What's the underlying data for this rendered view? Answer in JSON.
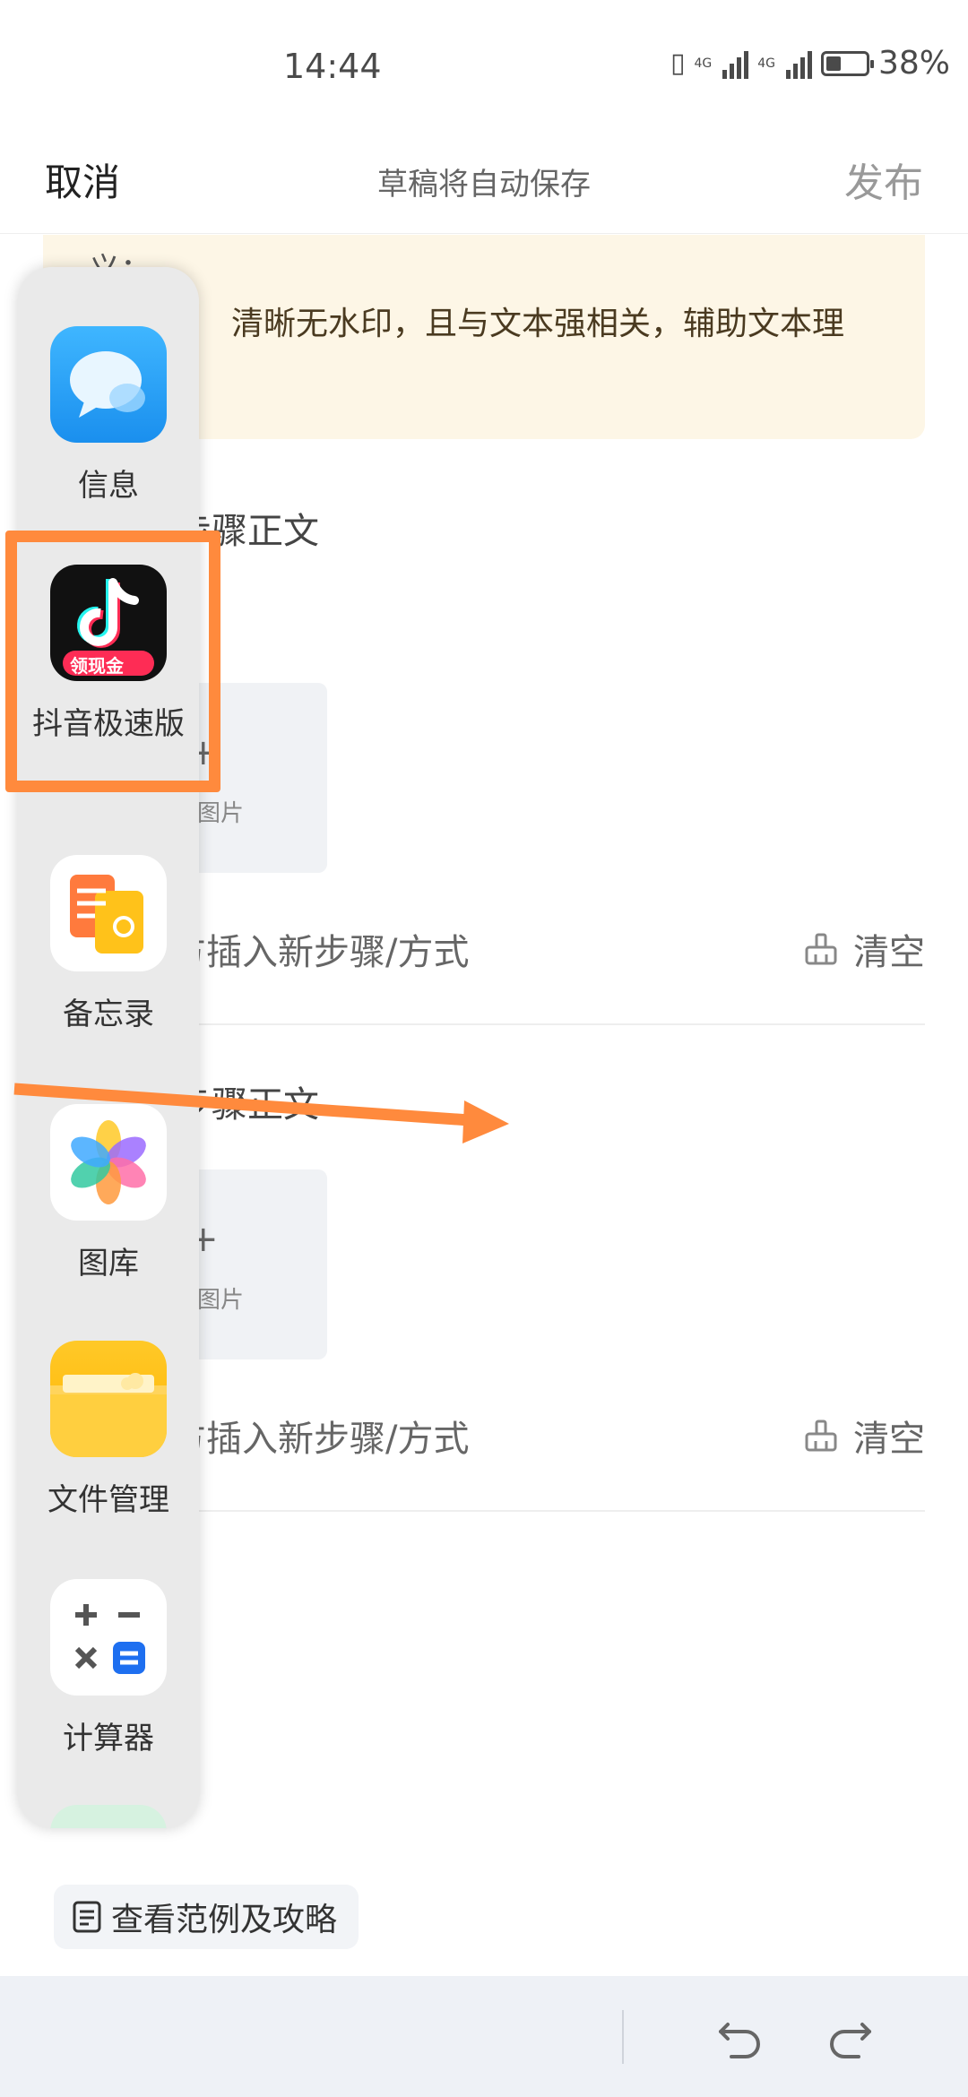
{
  "status_bar": {
    "time": "14:44",
    "network1": "4G",
    "network2": "4G",
    "battery": "38%",
    "battery_level": 0.38
  },
  "header": {
    "cancel": "取消",
    "draft": "草稿将自动保存",
    "publish": "发布"
  },
  "tip": {
    "line1": "义：",
    "line2": "清晰无水印，且与文本强相关，辅助文本理"
  },
  "steps": [
    {
      "title_fragment": "步骤正文",
      "image_label": "图片",
      "insert_label": "方插入新步骤/方式",
      "clear_label": "清空"
    },
    {
      "title_fragment": "步骤正文",
      "image_label": "图片",
      "insert_label": "方插入新步骤/方式",
      "clear_label": "清空"
    }
  ],
  "guide": {
    "label": "查看范例及攻略"
  },
  "dock": {
    "apps": [
      {
        "name": "信息",
        "icon": "messages-icon"
      },
      {
        "name": "抖音极速版",
        "icon": "douyin-lite-icon",
        "badge": "领现金"
      },
      {
        "name": "备忘录",
        "icon": "notes-icon"
      },
      {
        "name": "图库",
        "icon": "gallery-icon"
      },
      {
        "name": "文件管理",
        "icon": "file-manager-icon"
      },
      {
        "name": "计算器",
        "icon": "calculator-icon"
      }
    ]
  },
  "colors": {
    "highlight": "#ff8a3d",
    "dock_bg": "#eaeaea",
    "tip_bg": "#fdf6e6"
  }
}
